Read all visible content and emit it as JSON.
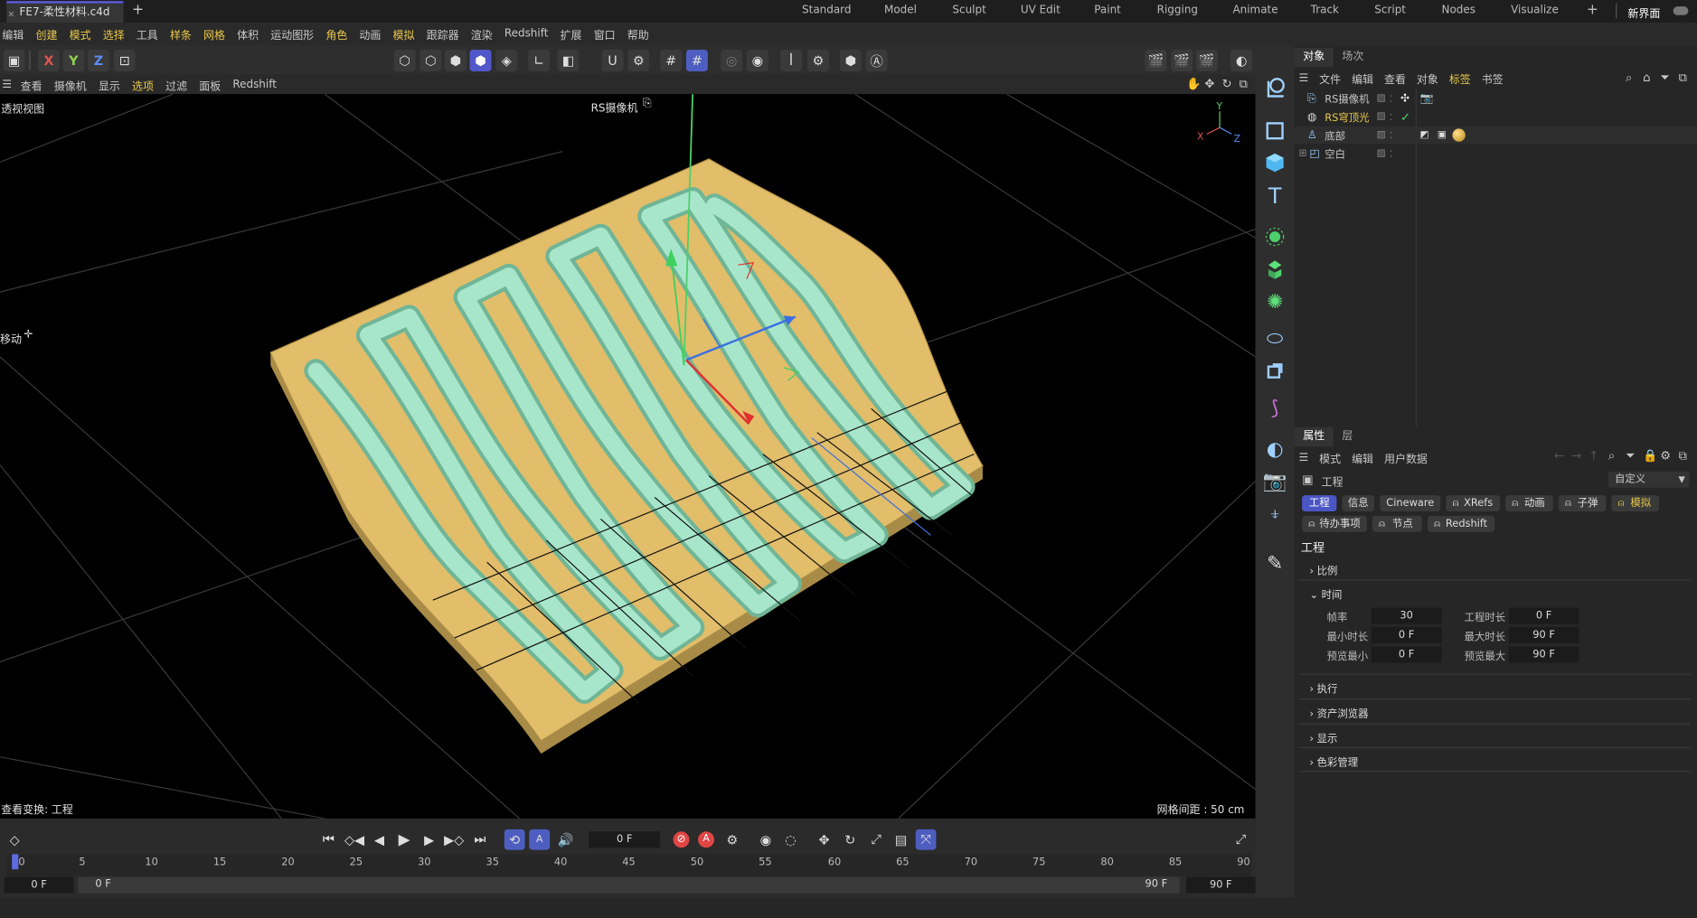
{
  "document_tab": "FE7-柔性材料.c4d",
  "layouts": [
    "Standard",
    "Model",
    "Sculpt",
    "UV Edit",
    "Paint",
    "Rigging",
    "Animate",
    "Track",
    "Script",
    "Nodes",
    "Visualize"
  ],
  "new_interface_label": "新界面",
  "menu": [
    "编辑",
    "创建",
    "模式",
    "选择",
    "工具",
    "样条",
    "网格",
    "体积",
    "运动图形",
    "角色",
    "动画",
    "模拟",
    "跟踪器",
    "渲染",
    "Redshift",
    "扩展",
    "窗口",
    "帮助"
  ],
  "axis_buttons": [
    "X",
    "Y",
    "Z"
  ],
  "viewport_menu": [
    "查看",
    "摄像机",
    "显示",
    "选项",
    "过滤",
    "面板",
    "Redshift"
  ],
  "viewport": {
    "view_name": "透视视图",
    "camera_label": "RS摄像机",
    "tool_label": "移动",
    "view_transform": "查看变换: 工程",
    "grid_spacing": "网格间距 : 50 cm",
    "axes": {
      "x": "X",
      "y": "Y",
      "z": "Z"
    }
  },
  "object_manager": {
    "tabs": [
      "对象",
      "场次"
    ],
    "menu": [
      "文件",
      "编辑",
      "查看",
      "对象",
      "标签",
      "书签"
    ],
    "objects": [
      {
        "name": "RS摄像机",
        "highlight": false
      },
      {
        "name": "RS穹顶光",
        "highlight": true
      },
      {
        "name": "底部",
        "highlight": false
      },
      {
        "name": "空白",
        "highlight": false
      }
    ]
  },
  "attributes": {
    "tabs": [
      "属性",
      "层"
    ],
    "menu": [
      "模式",
      "编辑",
      "用户数据"
    ],
    "context": "工程",
    "preset": "自定义",
    "buttons_row1": [
      "工程",
      "信息",
      "Cineware",
      "XRefs",
      "动画",
      "子弹",
      "模拟"
    ],
    "buttons_row2": [
      "待办事项",
      "节点",
      "Redshift"
    ],
    "section_title": "工程",
    "sections": [
      "比例",
      "时间",
      "执行",
      "资产浏览器",
      "显示",
      "色彩管理"
    ],
    "time_fields": [
      {
        "label": "帧率",
        "value": "30"
      },
      {
        "label": "工程时长",
        "value": "0 F"
      },
      {
        "label": "最小时长",
        "value": "0 F"
      },
      {
        "label": "最大时长",
        "value": "90 F"
      },
      {
        "label": "预览最小",
        "value": "0 F"
      },
      {
        "label": "预览最大",
        "value": "90 F"
      }
    ]
  },
  "timeline": {
    "current_frame": "0 F",
    "ticks": [
      "0",
      "5",
      "10",
      "15",
      "20",
      "25",
      "30",
      "35",
      "40",
      "45",
      "50",
      "55",
      "60",
      "65",
      "70",
      "75",
      "80",
      "85",
      "90"
    ],
    "range_start": "0 F",
    "range_start2": "0 F",
    "range_end": "90 F",
    "range_end2": "90 F"
  },
  "colors": {
    "accent": "#5157c8",
    "highlight": "#e8c84a",
    "base": "#e2bd6a",
    "tube": "#a8e6cc"
  }
}
